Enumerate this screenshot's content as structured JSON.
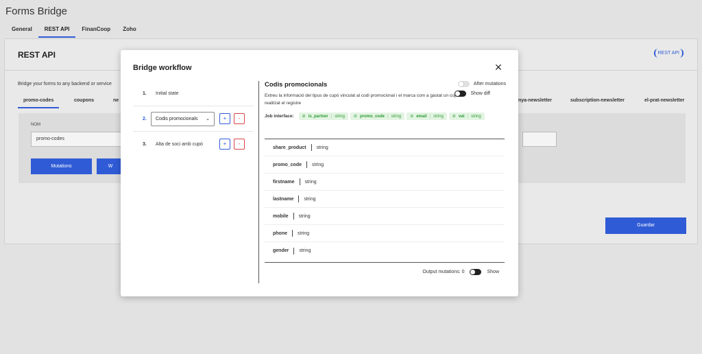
{
  "app": {
    "title": "Forms Bridge"
  },
  "top_tabs": [
    {
      "label": "General",
      "active": false
    },
    {
      "label": "REST API",
      "active": true
    },
    {
      "label": "FinanCoop",
      "active": false
    },
    {
      "label": "Zoho",
      "active": false
    }
  ],
  "panel": {
    "title": "REST API",
    "logo_text": "REST API",
    "description": "Bridge your forms to any backend or service",
    "form_tabs": [
      "promo-codes",
      "coupons",
      "ne",
      "nya-newsletter",
      "subscription-newsletter",
      "el-prat-newsletter"
    ],
    "field_label": "NOM",
    "field_value": "promo-codes",
    "mutations_button": "Mutations",
    "second_button": "W",
    "save_button": "Guardar"
  },
  "modal": {
    "title": "Bridge workflow",
    "close_icon": "close-icon",
    "steps": [
      {
        "number": "1.",
        "label": "Initial state"
      },
      {
        "number": "2.",
        "label": "Codis promocionals",
        "selected": true
      },
      {
        "number": "3.",
        "label": "Alta de soci amb cupó"
      }
    ],
    "add_label": "+",
    "remove_label": "-",
    "job": {
      "title": "Codis promocionals",
      "description": "Extreu la informació del tipus de cupó vinculat al codi promocional i el marca com a gastat un cop realitzat el registre",
      "after_mutations_label": "After mutations",
      "show_diff_label": "Show diff",
      "interface_label": "Job interface:",
      "interface": [
        {
          "name": "is_partner",
          "type": "string"
        },
        {
          "name": "promo_code",
          "type": "string"
        },
        {
          "name": "email",
          "type": "string"
        },
        {
          "name": "vat",
          "type": "string"
        }
      ],
      "fields": [
        {
          "name": "share_product",
          "type": "string"
        },
        {
          "name": "promo_code",
          "type": "string"
        },
        {
          "name": "firstname",
          "type": "string"
        },
        {
          "name": "lastname",
          "type": "string"
        },
        {
          "name": "mobile",
          "type": "string"
        },
        {
          "name": "phone",
          "type": "string"
        },
        {
          "name": "gender",
          "type": "string"
        }
      ],
      "output_mutations_label": "Output mutations: 0",
      "show_label": "Show"
    }
  },
  "colors": {
    "accent": "#2f5bd6",
    "danger": "#d64545",
    "success": "#2c9a35"
  }
}
